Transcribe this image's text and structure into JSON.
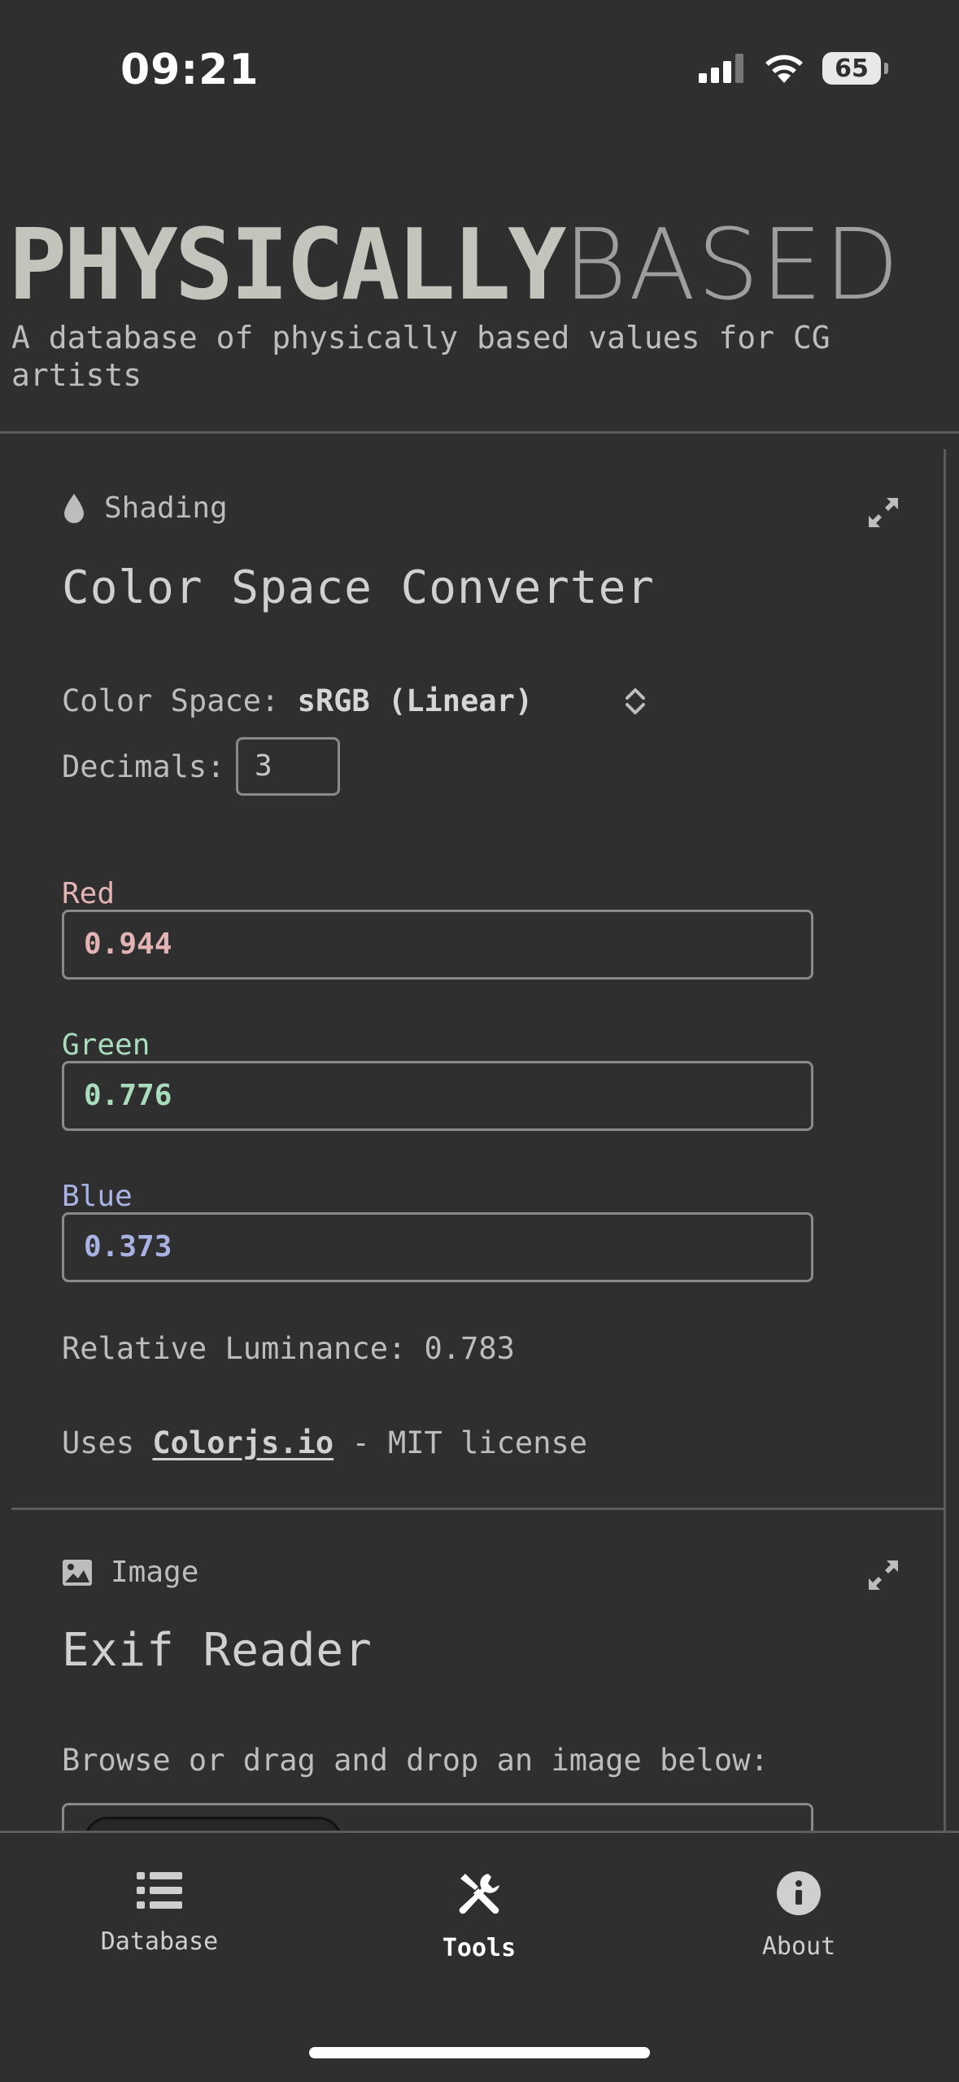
{
  "status_bar": {
    "time": "09:21",
    "battery": "65"
  },
  "header": {
    "brand_bold": "PHYSICALLY",
    "brand_light": "BASED",
    "tagline": "A database of physically based values for CG artists"
  },
  "color_converter": {
    "category": "Shading",
    "title": "Color Space Converter",
    "color_space_label": "Color Space:",
    "color_space_value": "sRGB (Linear)",
    "decimals_label": "Decimals:",
    "decimals_value": "3",
    "red_label": "Red",
    "red_value": "0.944",
    "green_label": "Green",
    "green_value": "0.776",
    "blue_label": "Blue",
    "blue_value": "0.373",
    "luminance_text": "Relative Luminance: 0.783",
    "uses_prefix": "Uses",
    "uses_link": "Colorjs.io",
    "uses_suffix": "- MIT license"
  },
  "exif_reader": {
    "category": "Image",
    "title": "Exif Reader",
    "instructions": "Browse or drag and drop an image below:"
  },
  "nav": {
    "database": "Database",
    "tools": "Tools",
    "about": "About"
  },
  "colors": {
    "background": "#2f2f2f",
    "red_channel": "#e3b3b3",
    "green_channel": "#a9dcbc",
    "blue_channel": "#a8b3e4"
  },
  "icons": {
    "shading": "droplet-icon",
    "image": "image-icon",
    "expand": "expand-icon",
    "database": "list-icon",
    "tools": "tools-icon",
    "about": "info-icon"
  }
}
